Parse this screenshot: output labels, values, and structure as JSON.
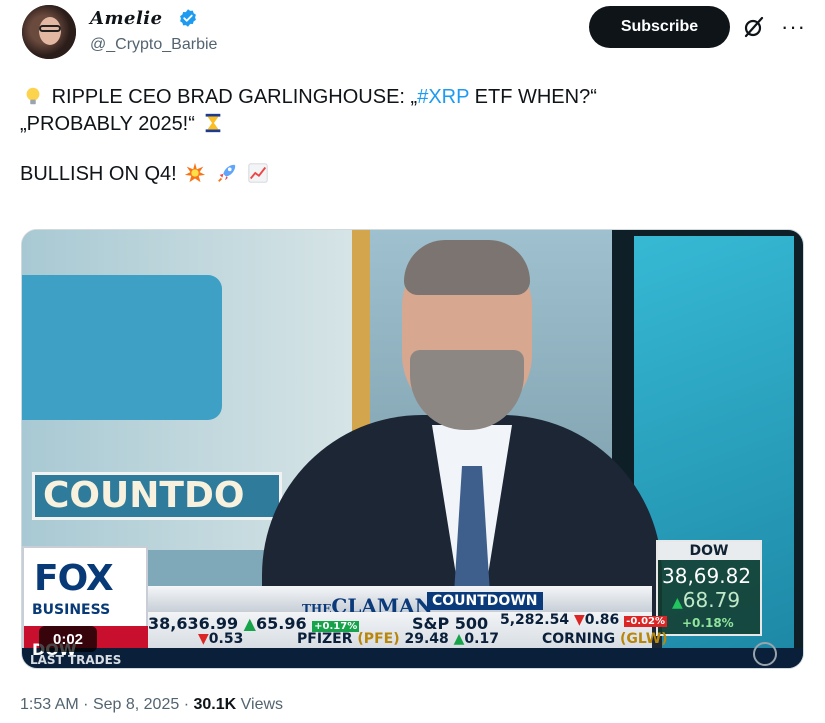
{
  "author": {
    "display_name": "Amelie",
    "handle": "@_Crypto_Barbie",
    "verified": true
  },
  "actions": {
    "subscribe_label": "Subscribe",
    "grok_icon": "grok-slash-icon",
    "more_icon": "more-dots-icon"
  },
  "tweet": {
    "line1_pre": "RIPPLE CEO BRAD GARLINGHOUSE: „",
    "hashtag": "#XRP",
    "line1_post": " ETF WHEN?“",
    "line2": "„PROBABLY 2025!“",
    "line3": "BULLISH ON Q4!",
    "emojis": [
      "lightbulb-emoji",
      "hourglass-emoji",
      "collision-emoji",
      "rocket-emoji",
      "chart-increasing-emoji"
    ]
  },
  "media": {
    "video_time": "0:02",
    "sign_text": "COUNTDO",
    "network_logo": "FOX",
    "network_sub": "BUSINESS",
    "live_text": "LIVE",
    "show_name_prefix": "THE",
    "show_name_1": "CLAMAN",
    "show_name_2": "COUNTDOWN",
    "dow_box": {
      "label": "DOW",
      "value": "38,6",
      "value_rest": "9.82",
      "change": "68.79",
      "percent": "+0.18%"
    },
    "ticker": {
      "dow_label": "DOW",
      "dow_value": "38,636.99",
      "dow_change": "65.96",
      "dow_pct": "+0.17%",
      "sp_label": "S&P 500",
      "sp_value": "5,282.54",
      "sp_change": "0.86",
      "sp_pct": "-0.02%",
      "pfe_label": "PFIZER",
      "pfe_symbol": "(PFE)",
      "pfe_value": "29.48",
      "pfe_change": "0.17",
      "glw_label": "CORNING",
      "glw_symbol": "(GLW)",
      "left_change": "0.53",
      "last_trades": "LAST TRADES"
    }
  },
  "meta": {
    "time": "1:53 AM",
    "date": "Sep 8, 2025",
    "views_count": "30.1K",
    "views_label": "Views"
  }
}
